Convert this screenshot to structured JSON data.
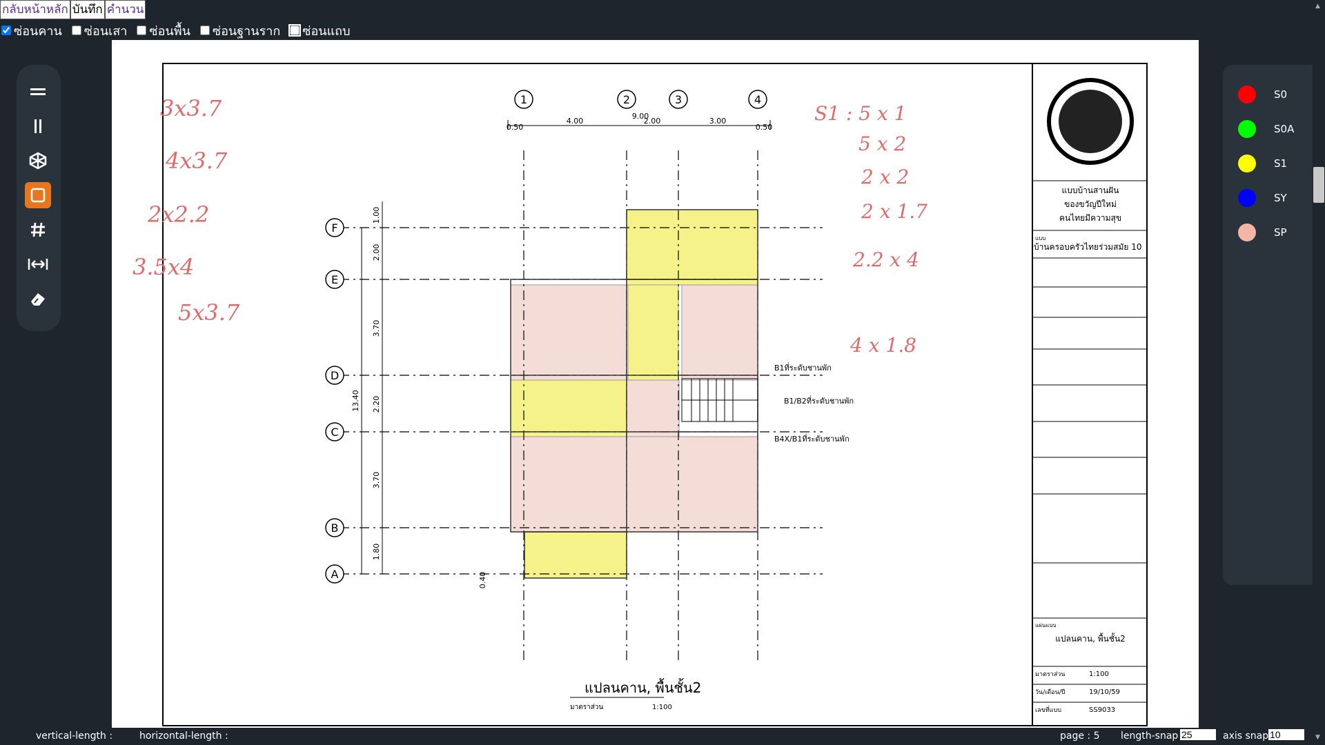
{
  "nav": {
    "home_label": "กลับหน้าหลัก",
    "save_label": "บันทึก",
    "calc_label": "คำนวน"
  },
  "toggles": [
    {
      "label": "ซ่อนคาน",
      "checked": true
    },
    {
      "label": "ซ่อนเสา",
      "checked": false
    },
    {
      "label": "ซ่อนพื้น",
      "checked": false
    },
    {
      "label": "ซ่อนฐานราก",
      "checked": false
    },
    {
      "label": "ซ่อนแถบ",
      "checked": false
    }
  ],
  "tools": [
    {
      "name": "beam-tool-icon",
      "active": false
    },
    {
      "name": "column-tool-icon",
      "active": false
    },
    {
      "name": "footing-tool-icon",
      "active": false
    },
    {
      "name": "slab-tool-icon",
      "active": true
    },
    {
      "name": "grid-tool-icon",
      "active": false
    },
    {
      "name": "dimension-tool-icon",
      "active": false
    },
    {
      "name": "eraser-tool-icon",
      "active": false
    }
  ],
  "palette": [
    {
      "label": "S0",
      "color": "#ff0000"
    },
    {
      "label": "S0A",
      "color": "#00ff00"
    },
    {
      "label": "S1",
      "color": "#ffff00"
    },
    {
      "label": "SY",
      "color": "#0000ff"
    },
    {
      "label": "SP",
      "color": "#f4b5a4"
    }
  ],
  "drawing": {
    "grid_cols": [
      "1",
      "2",
      "3",
      "4"
    ],
    "grid_rows": [
      "F",
      "E",
      "D",
      "C",
      "B",
      "A"
    ],
    "top_dims": [
      "0.50",
      "4.00",
      "9.00",
      "2.00",
      "3.00",
      "0.50"
    ],
    "left_dims": [
      "1.00",
      "2.00",
      "3.70",
      "13.40",
      "2.20",
      "3.70",
      "1.80",
      "0.40"
    ],
    "plan_title": "แปลนคาน, พื้นชั้น2",
    "plan_scale_label": "มาตราส่วน",
    "plan_scale": "1:100",
    "notes": [
      "B1ที่ระดับชานพัก",
      "B1/B2ที่ระดับชานพัก",
      "B4X/B1ที่ระดับชานพัก"
    ],
    "handwritten_left": [
      "3x3.7",
      "4x3.7",
      "2x2.2",
      "3.5x4",
      "5x3.7"
    ],
    "handwritten_right": [
      "S1 : 5 x 1",
      "5 x 2",
      "2 x 2",
      "2 x 1.7",
      "2.2 x 4",
      "4 x 1.8"
    ]
  },
  "title_block": {
    "project_lines": [
      "แบบบ้านสานฝัน",
      "ของขวัญปีใหม่",
      "คนไทยมีความสุข"
    ],
    "type_label": "แบบ",
    "type_value": "บ้านครอบครัวไทยร่วมสมัย 10",
    "sheet_label": "แผ่นแบบ",
    "sheet_value": "แปลนคาน, พื้นชั้น2",
    "scale_label": "มาตราส่วน",
    "scale_value": "1:100",
    "date_label": "วัน/เดือน/ปี",
    "date_value": "19/10/59",
    "number_label": "เลขที่แบบ",
    "number_value": "SS9033"
  },
  "status": {
    "vertical_label": "vertical-length :",
    "horizontal_label": "horizontal-length :",
    "page_label": "page : 5",
    "length_snap_label": "length-snap :",
    "length_snap_value": "25",
    "axis_snap_label": "axis snap :",
    "axis_snap_value": "10"
  }
}
